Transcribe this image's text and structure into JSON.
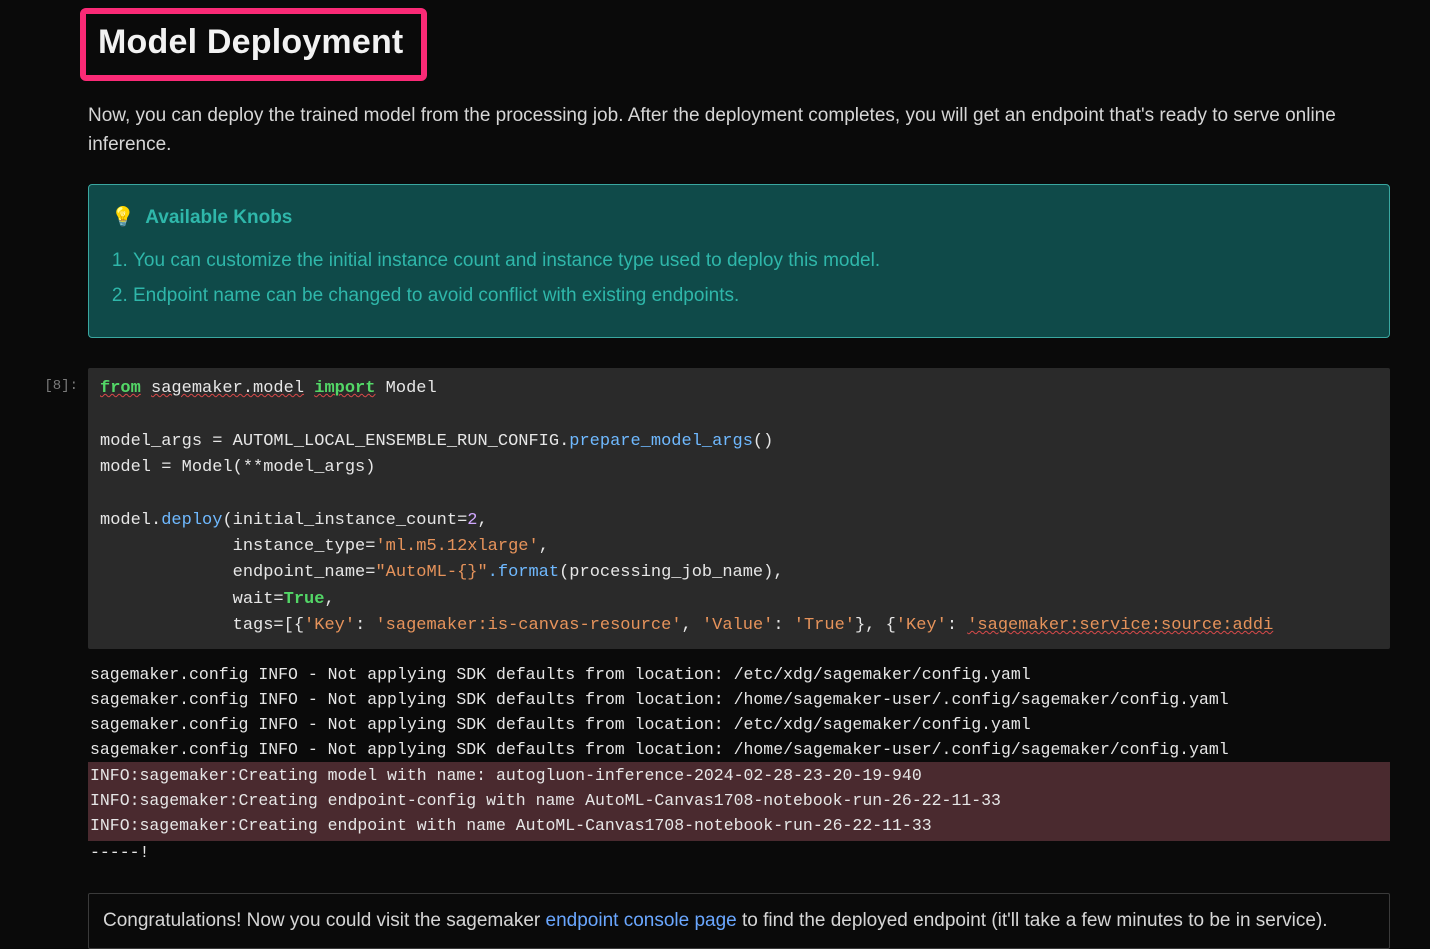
{
  "heading": "Model Deployment",
  "description": "Now, you can deploy the trained model from the processing job. After the deployment completes, you will get an endpoint that's ready to serve online inference.",
  "callout": {
    "icon": "💡",
    "title": "Available Knobs",
    "items": [
      "You can customize the initial instance count and instance type used to deploy this model.",
      "Endpoint name can be changed to avoid conflict with existing endpoints."
    ]
  },
  "cell": {
    "prompt": "[8]:",
    "code": {
      "l1_from": "from",
      "l1_mod": "sagemaker.model",
      "l1_import": "import",
      "l1_name": "Model",
      "l2": "model_args = AUTOML_LOCAL_ENSEMBLE_RUN_CONFIG.",
      "l2_fn": "prepare_model_args",
      "l2_tail": "()",
      "l3": "model = Model(**model_args)",
      "l4_head": "model.",
      "l4_fn": "deploy",
      "l4_arg1k": "(initial_instance_count=",
      "l4_arg1v": "2",
      "l5_k": "             instance_type=",
      "l5_v": "'ml.m5.12xlarge'",
      "l6_k": "             endpoint_name=",
      "l6_v": "\"AutoML-{}\"",
      "l6_fn": ".format",
      "l6_tail": "(processing_job_name),",
      "l7_k": "             wait=",
      "l7_v": "True",
      "l8_k": "             tags=[{",
      "l8_k1": "'Key'",
      "l8_sep": ": ",
      "l8_v1": "'sagemaker:is-canvas-resource'",
      "l8_c": ", ",
      "l8_k2": "'Value'",
      "l8_v2": "'True'",
      "l8_close": "}, {",
      "l8_k3": "'Key'",
      "l8_v3": "'sagemaker:service:source:addi"
    }
  },
  "output": {
    "plain": [
      "sagemaker.config INFO - Not applying SDK defaults from location: /etc/xdg/sagemaker/config.yaml",
      "sagemaker.config INFO - Not applying SDK defaults from location: /home/sagemaker-user/.config/sagemaker/config.yaml",
      "sagemaker.config INFO - Not applying SDK defaults from location: /etc/xdg/sagemaker/config.yaml",
      "sagemaker.config INFO - Not applying SDK defaults from location: /home/sagemaker-user/.config/sagemaker/config.yaml"
    ],
    "highlighted": [
      "INFO:sagemaker:Creating model with name: autogluon-inference-2024-02-28-23-20-19-940",
      "INFO:sagemaker:Creating endpoint-config with name AutoML-Canvas1708-notebook-run-26-22-11-33",
      "INFO:sagemaker:Creating endpoint with name AutoML-Canvas1708-notebook-run-26-22-11-33"
    ],
    "tail": "-----!"
  },
  "markdown": {
    "before_link": "Congratulations! Now you could visit the sagemaker ",
    "link_text": "endpoint console page",
    "after_link": " to find the deployed endpoint (it'll take a few minutes to be in service)."
  }
}
